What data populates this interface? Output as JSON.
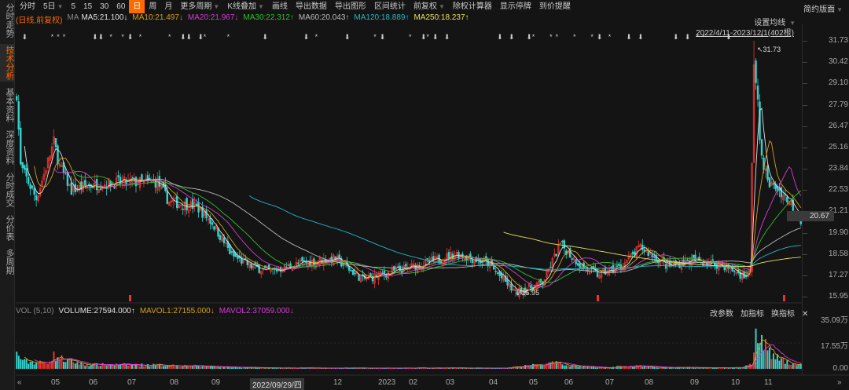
{
  "sidebar": {
    "items": [
      {
        "label": "分时走势"
      },
      {
        "label": "技术分析",
        "active": true
      },
      {
        "label": "基本资料"
      },
      {
        "label": "深度资料"
      },
      {
        "label": "分时成交"
      },
      {
        "label": "分价表"
      },
      {
        "label": "多周期"
      }
    ]
  },
  "toolbar": {
    "items": [
      "分时",
      "5日",
      "5",
      "15",
      "30",
      "60",
      "日",
      "周",
      "月",
      "更多周期",
      "K线叠加",
      "画线",
      "导出数据",
      "导出图形",
      "区间统计",
      "前复权",
      "除权计算器",
      "显示停牌",
      "到价提醒"
    ],
    "active": "日",
    "right": "简约版面"
  },
  "legend": {
    "mode": "(日线,前复权)",
    "ma": "MA",
    "items": [
      {
        "text": "MA5:21.100↓",
        "color": "#e0e0e0"
      },
      {
        "text": "MA10:21.497↓",
        "color": "#d4a017"
      },
      {
        "text": "MA20:21.967↓",
        "color": "#d23fd2"
      },
      {
        "text": "MA30:22.312↑",
        "color": "#2fbf2f"
      },
      {
        "text": "MA60:20.043↑",
        "color": "#bbbbbb"
      },
      {
        "text": "MA120:18.889↑",
        "color": "#1fb8c8"
      },
      {
        "text": "MA250:18.237↑",
        "color": "#e6e05a"
      }
    ]
  },
  "set_ma": "设置均线",
  "range": "2022/4/11-2023/12/1(402根)",
  "price_axis": [
    "31.73",
    "30.42",
    "29.10",
    "27.79",
    "26.47",
    "25.16",
    "23.84",
    "22.53",
    "21.21",
    "19.90",
    "18.58",
    "17.27",
    "15.95"
  ],
  "current_price": "20.67",
  "annotations": {
    "high": "31.73",
    "low": "15.95"
  },
  "volume": {
    "title": "VOL (5,10)",
    "items": [
      {
        "text": "VOLUME:27594.000↑",
        "color": "#e0e0e0"
      },
      {
        "text": "MAVOL1:27155.000↓",
        "color": "#d4a017"
      },
      {
        "text": "MAVOL2:37059.000↓",
        "color": "#d23fd2"
      }
    ],
    "tools": [
      "改参数",
      "加指标",
      "换指标"
    ],
    "close": "✕",
    "axis": [
      "35.09万",
      "17.55万",
      "0.00"
    ]
  },
  "x_axis": [
    "05",
    "06",
    "07",
    "08",
    "09",
    "2022/09/29/四",
    "12",
    "2023",
    "02",
    "03",
    "04",
    "05",
    "06",
    "07",
    "08",
    "09",
    "10",
    "11"
  ],
  "colors": {
    "up": "#e8342e",
    "down": "#34d1cc",
    "accent": "#ff6a00"
  },
  "chart_data": {
    "type": "candlestick",
    "count": 402,
    "price_range": [
      15.95,
      31.73
    ],
    "close_anchors": [
      [
        0,
        28.5
      ],
      [
        2,
        24
      ],
      [
        6,
        23
      ],
      [
        10,
        22
      ],
      [
        14,
        23.5
      ],
      [
        19,
        25.5
      ],
      [
        22,
        24
      ],
      [
        28,
        22.5
      ],
      [
        36,
        22.8
      ],
      [
        52,
        23
      ],
      [
        72,
        23
      ],
      [
        78,
        21.8
      ],
      [
        92,
        21.5
      ],
      [
        100,
        20.5
      ],
      [
        110,
        18.5
      ],
      [
        120,
        17.8
      ],
      [
        130,
        17.5
      ],
      [
        145,
        18
      ],
      [
        163,
        18.3
      ],
      [
        177,
        17
      ],
      [
        193,
        17.5
      ],
      [
        209,
        18
      ],
      [
        225,
        18.6
      ],
      [
        241,
        18
      ],
      [
        255,
        16.2
      ],
      [
        269,
        16.8
      ],
      [
        278,
        19.2
      ],
      [
        289,
        17.8
      ],
      [
        297,
        17.3
      ],
      [
        309,
        17.8
      ],
      [
        319,
        19
      ],
      [
        333,
        17.8
      ],
      [
        345,
        18.2
      ],
      [
        361,
        17.9
      ],
      [
        372,
        17.2
      ],
      [
        375,
        17.5
      ],
      [
        377,
        30.5
      ],
      [
        379,
        28
      ],
      [
        380,
        25.3
      ],
      [
        384,
        23
      ],
      [
        390,
        22.5
      ],
      [
        396,
        21.7
      ],
      [
        401,
        20.67
      ]
    ],
    "volume_anchors_wan": [
      [
        0,
        10
      ],
      [
        4,
        5
      ],
      [
        15,
        4
      ],
      [
        19,
        9
      ],
      [
        25,
        6
      ],
      [
        35,
        3
      ],
      [
        80,
        2.5
      ],
      [
        110,
        1.2
      ],
      [
        130,
        0.6
      ],
      [
        250,
        0.6
      ],
      [
        275,
        4
      ],
      [
        285,
        2
      ],
      [
        300,
        0.8
      ],
      [
        315,
        2
      ],
      [
        330,
        1
      ],
      [
        370,
        0.7
      ],
      [
        376,
        3
      ],
      [
        378,
        33
      ],
      [
        381,
        20
      ],
      [
        386,
        9
      ],
      [
        395,
        4
      ],
      [
        401,
        2.7
      ]
    ],
    "volume_range_wan": [
      0,
      35.09
    ]
  }
}
